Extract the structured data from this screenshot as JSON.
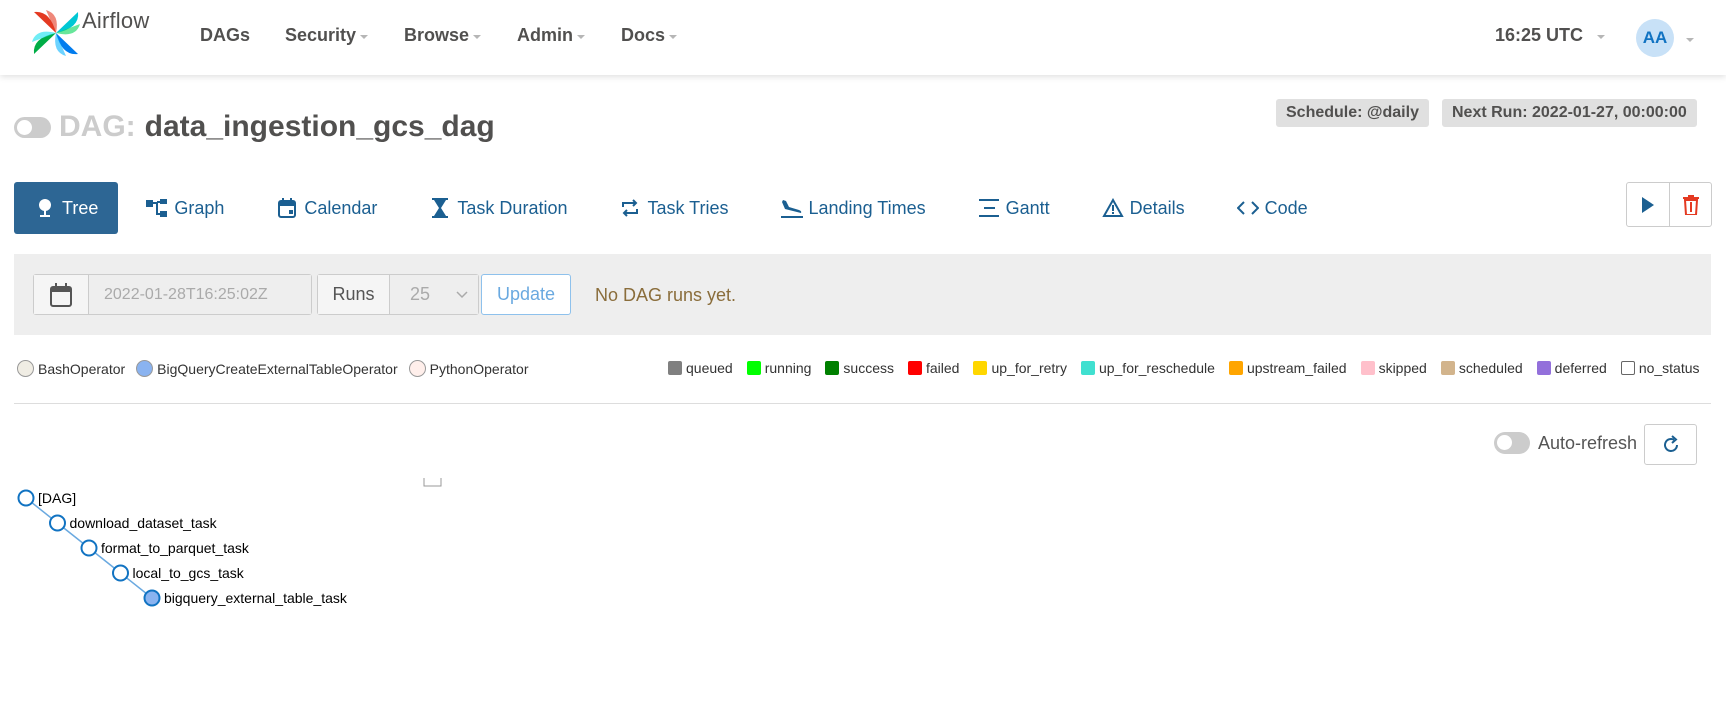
{
  "navbar": {
    "brand": "Airflow",
    "items": [
      {
        "label": "DAGs",
        "dropdown": false
      },
      {
        "label": "Security",
        "dropdown": true
      },
      {
        "label": "Browse",
        "dropdown": true
      },
      {
        "label": "Admin",
        "dropdown": true
      },
      {
        "label": "Docs",
        "dropdown": true
      }
    ],
    "clock": "16:25 UTC",
    "avatar": "AA"
  },
  "dag": {
    "label": "DAG:",
    "id": "data_ingestion_gcs_dag",
    "paused": true,
    "schedule": "Schedule: @daily",
    "next_run": "Next Run: 2022-01-27, 00:00:00"
  },
  "tabs": [
    {
      "label": "Tree",
      "icon": "tree-icon",
      "active": true
    },
    {
      "label": "Graph",
      "icon": "graph-icon"
    },
    {
      "label": "Calendar",
      "icon": "calendar-icon"
    },
    {
      "label": "Task Duration",
      "icon": "hourglass-icon"
    },
    {
      "label": "Task Tries",
      "icon": "repeat-icon"
    },
    {
      "label": "Landing Times",
      "icon": "plane-landing-icon"
    },
    {
      "label": "Gantt",
      "icon": "gantt-icon"
    },
    {
      "label": "Details",
      "icon": "warning-triangle-icon"
    },
    {
      "label": "Code",
      "icon": "code-icon"
    }
  ],
  "filter": {
    "base_date": "2022-01-28T16:25:02Z",
    "runs_label": "Runs",
    "runs_value": "25",
    "update_label": "Update",
    "message": "No DAG runs yet."
  },
  "operators": [
    {
      "name": "BashOperator",
      "color": "#f0ede4"
    },
    {
      "name": "BigQueryCreateExternalTableOperator",
      "color": "#8ab3f0"
    },
    {
      "name": "PythonOperator",
      "color": "#ffefeb"
    }
  ],
  "states": [
    {
      "name": "queued",
      "color": "#808080"
    },
    {
      "name": "running",
      "color": "#00ff00"
    },
    {
      "name": "success",
      "color": "#008000"
    },
    {
      "name": "failed",
      "color": "#ff0000"
    },
    {
      "name": "up_for_retry",
      "color": "#ffd700"
    },
    {
      "name": "up_for_reschedule",
      "color": "#40e0d0"
    },
    {
      "name": "upstream_failed",
      "color": "#ffa500"
    },
    {
      "name": "skipped",
      "color": "#ffc0cb"
    },
    {
      "name": "scheduled",
      "color": "#d2b48c"
    },
    {
      "name": "deferred",
      "color": "#9370db"
    },
    {
      "name": "no_status",
      "color": "#ffffff"
    }
  ],
  "auto_refresh": "Auto-refresh",
  "tree": [
    {
      "label": "[DAG]",
      "fill": "#ffffff"
    },
    {
      "label": "download_dataset_task",
      "fill": "#ffffff"
    },
    {
      "label": "format_to_parquet_task",
      "fill": "#ffffff"
    },
    {
      "label": "local_to_gcs_task",
      "fill": "#ffffff"
    },
    {
      "label": "bigquery_external_table_task",
      "fill": "#8ab3f0"
    }
  ]
}
